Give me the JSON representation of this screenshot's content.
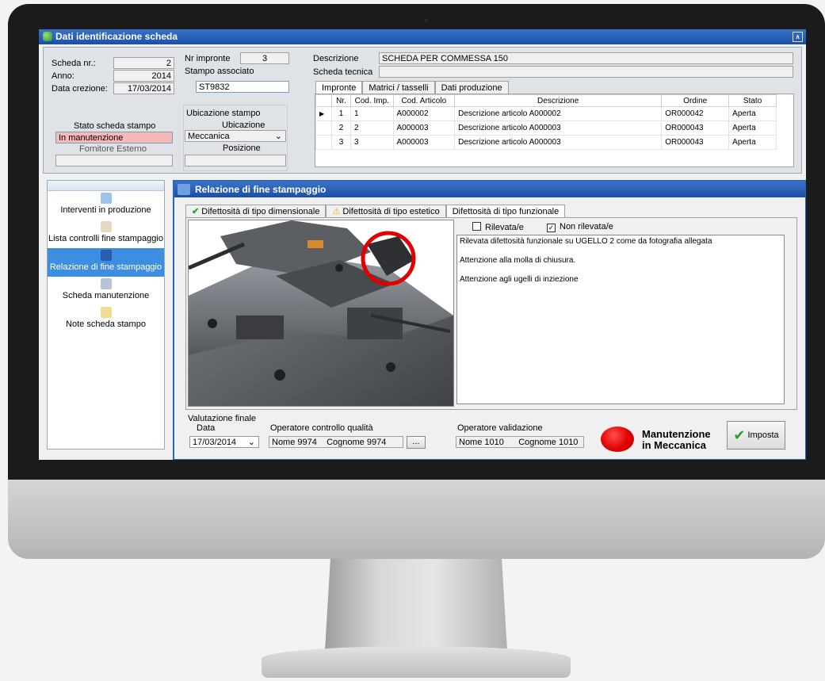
{
  "window": {
    "title": "Dati identificazione scheda"
  },
  "scheda": {
    "nr_label": "Scheda nr.:",
    "nr_value": "2",
    "anno_label": "Anno:",
    "anno_value": "2014",
    "data_label": "Data crezione:",
    "data_value": "17/03/2014",
    "stato_label": "Stato scheda stampo",
    "stato_value": "In manutenzione",
    "fornitore_label": "Fornitore Esterno",
    "fornitore_value": ""
  },
  "stampo": {
    "impronte_label": "Nr impronte",
    "impronte_value": "3",
    "associato_label": "Stampo associato",
    "associato_value": "ST9832",
    "ubicazione_group": "Ubicazione stampo",
    "ubicazione_label": "Ubicazione",
    "ubicazione_value": "Meccanica",
    "posizione_label": "Posizione",
    "posizione_value": ""
  },
  "descrizione": {
    "label": "Descrizione",
    "value": "SCHEDA PER COMMESSA 150",
    "tecnica_label": "Scheda tecnica",
    "tecnica_value": ""
  },
  "top_tabs": [
    "Impronte",
    "Matrici / tasselli",
    "Dati produzione"
  ],
  "grid": {
    "columns": [
      "Nr.",
      "Cod. Imp.",
      "Cod. Articolo",
      "Descrizione",
      "Ordine",
      "Stato"
    ],
    "rows": [
      [
        "1",
        "1",
        "A000002",
        "Descrizione articolo A000002",
        "OR000042",
        "Aperta"
      ],
      [
        "2",
        "2",
        "A000003",
        "Descrizione articolo A000003",
        "OR000043",
        "Aperta"
      ],
      [
        "3",
        "3",
        "A000003",
        "Descrizione articolo A000003",
        "OR000043",
        "Aperta"
      ]
    ]
  },
  "nav": {
    "items": [
      {
        "label": "Interventi in produzione",
        "icon": "book-icon"
      },
      {
        "label": "Lista controlli fine stampaggio",
        "icon": "checklist-icon"
      },
      {
        "label": "Relazione di fine stampaggio",
        "icon": "report-icon"
      },
      {
        "label": "Scheda manutenzione",
        "icon": "gears-icon"
      },
      {
        "label": "Note scheda stampo",
        "icon": "notes-icon"
      }
    ]
  },
  "report": {
    "title": "Relazione di fine stampaggio",
    "tabs": [
      "Difettosità di tipo dimensionale",
      "Difettosità di tipo estetico",
      "Difettosità di tipo funzionale"
    ],
    "rilevata_label": "Rilevata/e",
    "non_rilevata_label": "Non rilevata/e",
    "notes": [
      "Rilevata difettosità funzionale su UGELLO 2 come da fotografia allegata",
      "Attenzione alla molla di chiusura.",
      "Attenzione agli ugelli di inziezione"
    ],
    "valutazione_label": "Valutazione finale",
    "data_label": "Data",
    "data_value": "17/03/2014",
    "operatore_qc_label": "Operatore controllo qualità",
    "operatore_qc_value": "Nome 9974    Cognome 9974",
    "browse_label": "...",
    "operatore_val_label": "Operatore validazione",
    "operatore_val_value": "Nome 1010      Cognome 1010",
    "status_line1": "Manutenzione",
    "status_line2": "in Meccanica",
    "imposta_label": "Imposta"
  },
  "colors": {
    "accent": "#1c4fa3",
    "status_red": "#e00000",
    "stato_field": "#f8b8b8",
    "nav_active": "#3d8ee0"
  }
}
